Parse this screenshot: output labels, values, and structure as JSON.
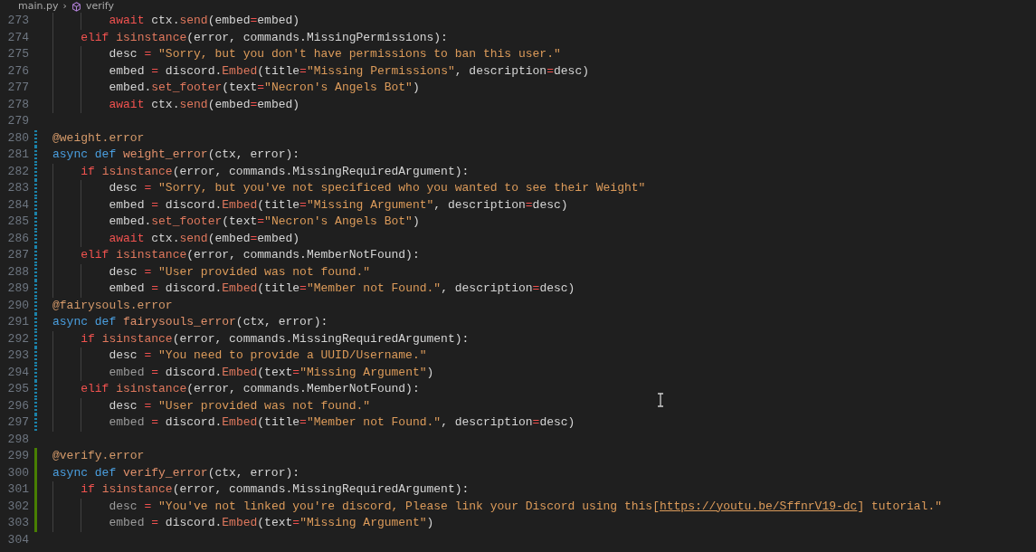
{
  "breadcrumb": {
    "file": "main.py",
    "separator": "›",
    "symbol": "verify"
  },
  "lines": [
    {
      "number": "273",
      "modified": false,
      "added": false,
      "tokens": [
        {
          "kind": "keyword",
          "text": "        await"
        },
        {
          "kind": "var",
          "text": " ctx."
        },
        {
          "kind": "call",
          "text": "send"
        },
        {
          "kind": "punc",
          "text": "(embed"
        },
        {
          "kind": "op",
          "text": "="
        },
        {
          "kind": "punc",
          "text": "embed)"
        }
      ]
    },
    {
      "number": "274",
      "modified": false,
      "added": false,
      "tokens": [
        {
          "kind": "keyword",
          "text": "    elif"
        },
        {
          "kind": "call",
          "text": " isinstance"
        },
        {
          "kind": "punc",
          "text": "(error, commands.MissingPermissions):"
        }
      ]
    },
    {
      "number": "275",
      "modified": false,
      "added": false,
      "tokens": [
        {
          "kind": "var",
          "text": "        desc "
        },
        {
          "kind": "op",
          "text": "="
        },
        {
          "kind": "string",
          "text": " \"Sorry, but you don't have permissions to ban this user.\""
        }
      ]
    },
    {
      "number": "276",
      "modified": false,
      "added": false,
      "tokens": [
        {
          "kind": "var",
          "text": "        embed "
        },
        {
          "kind": "op",
          "text": "="
        },
        {
          "kind": "var",
          "text": " discord."
        },
        {
          "kind": "call",
          "text": "Embed"
        },
        {
          "kind": "punc",
          "text": "(title"
        },
        {
          "kind": "op",
          "text": "="
        },
        {
          "kind": "string",
          "text": "\"Missing Permissions\""
        },
        {
          "kind": "punc",
          "text": ", description"
        },
        {
          "kind": "op",
          "text": "="
        },
        {
          "kind": "punc",
          "text": "desc)"
        }
      ]
    },
    {
      "number": "277",
      "modified": false,
      "added": false,
      "tokens": [
        {
          "kind": "var",
          "text": "        embed."
        },
        {
          "kind": "call",
          "text": "set_footer"
        },
        {
          "kind": "punc",
          "text": "(text"
        },
        {
          "kind": "op",
          "text": "="
        },
        {
          "kind": "string",
          "text": "\"Necron's Angels Bot\""
        },
        {
          "kind": "punc",
          "text": ")"
        }
      ]
    },
    {
      "number": "278",
      "modified": false,
      "added": false,
      "tokens": [
        {
          "kind": "keyword",
          "text": "        await"
        },
        {
          "kind": "var",
          "text": " ctx."
        },
        {
          "kind": "call",
          "text": "send"
        },
        {
          "kind": "punc",
          "text": "(embed"
        },
        {
          "kind": "op",
          "text": "="
        },
        {
          "kind": "punc",
          "text": "embed)"
        }
      ]
    },
    {
      "number": "279",
      "modified": false,
      "added": false
    },
    {
      "number": "280",
      "modified": true,
      "added": false,
      "tokens": [
        {
          "kind": "decorator",
          "text": "@weight.error"
        }
      ]
    },
    {
      "number": "281",
      "modified": true,
      "added": false,
      "tokens": [
        {
          "kind": "storage",
          "text": "async def"
        },
        {
          "kind": "function",
          "text": " weight_error"
        },
        {
          "kind": "punc",
          "text": "(ctx, error):"
        }
      ]
    },
    {
      "number": "282",
      "modified": true,
      "added": false,
      "tokens": [
        {
          "kind": "keyword",
          "text": "    if"
        },
        {
          "kind": "call",
          "text": " isinstance"
        },
        {
          "kind": "punc",
          "text": "(error, commands.MissingRequiredArgument):"
        }
      ]
    },
    {
      "number": "283",
      "modified": true,
      "added": false,
      "tokens": [
        {
          "kind": "var",
          "text": "        desc "
        },
        {
          "kind": "op",
          "text": "="
        },
        {
          "kind": "string",
          "text": " \"Sorry, but you've not specificed who you wanted to see their Weight\""
        }
      ]
    },
    {
      "number": "284",
      "modified": true,
      "added": false,
      "tokens": [
        {
          "kind": "var",
          "text": "        embed "
        },
        {
          "kind": "op",
          "text": "="
        },
        {
          "kind": "var",
          "text": " discord."
        },
        {
          "kind": "call",
          "text": "Embed"
        },
        {
          "kind": "punc",
          "text": "(title"
        },
        {
          "kind": "op",
          "text": "="
        },
        {
          "kind": "string",
          "text": "\"Missing Argument\""
        },
        {
          "kind": "punc",
          "text": ", description"
        },
        {
          "kind": "op",
          "text": "="
        },
        {
          "kind": "punc",
          "text": "desc)"
        }
      ]
    },
    {
      "number": "285",
      "modified": true,
      "added": false,
      "tokens": [
        {
          "kind": "var",
          "text": "        embed."
        },
        {
          "kind": "call",
          "text": "set_footer"
        },
        {
          "kind": "punc",
          "text": "(text"
        },
        {
          "kind": "op",
          "text": "="
        },
        {
          "kind": "string",
          "text": "\"Necron's Angels Bot\""
        },
        {
          "kind": "punc",
          "text": ")"
        }
      ]
    },
    {
      "number": "286",
      "modified": true,
      "added": false,
      "tokens": [
        {
          "kind": "keyword",
          "text": "        await"
        },
        {
          "kind": "var",
          "text": " ctx."
        },
        {
          "kind": "call",
          "text": "send"
        },
        {
          "kind": "punc",
          "text": "(embed"
        },
        {
          "kind": "op",
          "text": "="
        },
        {
          "kind": "punc",
          "text": "embed)"
        }
      ]
    },
    {
      "number": "287",
      "modified": true,
      "added": false,
      "tokens": [
        {
          "kind": "keyword",
          "text": "    elif"
        },
        {
          "kind": "call",
          "text": " isinstance"
        },
        {
          "kind": "punc",
          "text": "(error, commands.MemberNotFound):"
        }
      ]
    },
    {
      "number": "288",
      "modified": true,
      "added": false,
      "tokens": [
        {
          "kind": "var",
          "text": "        desc "
        },
        {
          "kind": "op",
          "text": "="
        },
        {
          "kind": "string",
          "text": " \"User provided was not found.\""
        }
      ]
    },
    {
      "number": "289",
      "modified": true,
      "added": false,
      "tokens": [
        {
          "kind": "var",
          "text": "        embed "
        },
        {
          "kind": "op",
          "text": "="
        },
        {
          "kind": "var",
          "text": " discord."
        },
        {
          "kind": "call",
          "text": "Embed"
        },
        {
          "kind": "punc",
          "text": "(title"
        },
        {
          "kind": "op",
          "text": "="
        },
        {
          "kind": "string",
          "text": "\"Member not Found.\""
        },
        {
          "kind": "punc",
          "text": ", description"
        },
        {
          "kind": "op",
          "text": "="
        },
        {
          "kind": "punc",
          "text": "desc)"
        }
      ]
    },
    {
      "number": "290",
      "modified": true,
      "added": false,
      "tokens": [
        {
          "kind": "decorator",
          "text": "@fairysouls.error"
        }
      ]
    },
    {
      "number": "291",
      "modified": true,
      "added": false,
      "tokens": [
        {
          "kind": "storage",
          "text": "async def"
        },
        {
          "kind": "function",
          "text": " fairysouls_error"
        },
        {
          "kind": "punc",
          "text": "(ctx, error):"
        }
      ]
    },
    {
      "number": "292",
      "modified": true,
      "added": false,
      "tokens": [
        {
          "kind": "keyword",
          "text": "    if"
        },
        {
          "kind": "call",
          "text": " isinstance"
        },
        {
          "kind": "punc",
          "text": "(error, commands.MissingRequiredArgument):"
        }
      ]
    },
    {
      "number": "293",
      "modified": true,
      "added": false,
      "tokens": [
        {
          "kind": "var",
          "text": "        desc "
        },
        {
          "kind": "op",
          "text": "="
        },
        {
          "kind": "string",
          "text": " \"You need to provide a UUID/Username.\""
        }
      ]
    },
    {
      "number": "294",
      "modified": true,
      "added": false,
      "tokens": [
        {
          "kind": "unused",
          "text": "        embed "
        },
        {
          "kind": "op",
          "text": "="
        },
        {
          "kind": "var",
          "text": " discord."
        },
        {
          "kind": "call",
          "text": "Embed"
        },
        {
          "kind": "punc",
          "text": "(text"
        },
        {
          "kind": "op",
          "text": "="
        },
        {
          "kind": "string",
          "text": "\"Missing Argument\""
        },
        {
          "kind": "punc",
          "text": ")"
        }
      ]
    },
    {
      "number": "295",
      "modified": true,
      "added": false,
      "tokens": [
        {
          "kind": "keyword",
          "text": "    elif"
        },
        {
          "kind": "call",
          "text": " isinstance"
        },
        {
          "kind": "punc",
          "text": "(error, commands.MemberNotFound):"
        }
      ]
    },
    {
      "number": "296",
      "modified": true,
      "added": false,
      "tokens": [
        {
          "kind": "var",
          "text": "        desc "
        },
        {
          "kind": "op",
          "text": "="
        },
        {
          "kind": "string",
          "text": " \"User provided was not found.\""
        }
      ]
    },
    {
      "number": "297",
      "modified": true,
      "added": false,
      "tokens": [
        {
          "kind": "unused",
          "text": "        embed "
        },
        {
          "kind": "op",
          "text": "="
        },
        {
          "kind": "var",
          "text": " discord."
        },
        {
          "kind": "call",
          "text": "Embed"
        },
        {
          "kind": "punc",
          "text": "(title"
        },
        {
          "kind": "op",
          "text": "="
        },
        {
          "kind": "string",
          "text": "\"Member not Found.\""
        },
        {
          "kind": "punc",
          "text": ", description"
        },
        {
          "kind": "op",
          "text": "="
        },
        {
          "kind": "punc",
          "text": "desc)"
        }
      ]
    },
    {
      "number": "298",
      "modified": false,
      "added": false
    },
    {
      "number": "299",
      "modified": false,
      "added": true,
      "tokens": [
        {
          "kind": "decorator",
          "text": "@verify.error"
        }
      ]
    },
    {
      "number": "300",
      "modified": false,
      "added": true,
      "tokens": [
        {
          "kind": "storage",
          "text": "async def"
        },
        {
          "kind": "function",
          "text": " verify_error"
        },
        {
          "kind": "punc",
          "text": "(ctx, error):"
        }
      ]
    },
    {
      "number": "301",
      "modified": false,
      "added": true,
      "tokens": [
        {
          "kind": "keyword",
          "text": "    if"
        },
        {
          "kind": "call",
          "text": " isinstance"
        },
        {
          "kind": "punc",
          "text": "(error, commands.MissingRequiredArgument):"
        }
      ]
    },
    {
      "number": "302",
      "modified": false,
      "added": true,
      "tokens": [
        {
          "kind": "unused",
          "text": "        desc "
        },
        {
          "kind": "op",
          "text": "="
        },
        {
          "kind": "string",
          "text": " \"You've not linked you're discord, Please link your Discord using this["
        },
        {
          "kind": "link",
          "text": "https://youtu.be/SffnrV19-dc"
        },
        {
          "kind": "string",
          "text": "] tutorial.\""
        }
      ]
    },
    {
      "number": "303",
      "modified": false,
      "added": true,
      "tokens": [
        {
          "kind": "unused",
          "text": "        embed "
        },
        {
          "kind": "op",
          "text": "="
        },
        {
          "kind": "var",
          "text": " discord."
        },
        {
          "kind": "call",
          "text": "Embed"
        },
        {
          "kind": "punc",
          "text": "(text"
        },
        {
          "kind": "op",
          "text": "="
        },
        {
          "kind": "string",
          "text": "\"Missing Argument\""
        },
        {
          "kind": "punc",
          "text": ")"
        }
      ]
    },
    {
      "number": "304",
      "modified": false,
      "added": false
    }
  ]
}
